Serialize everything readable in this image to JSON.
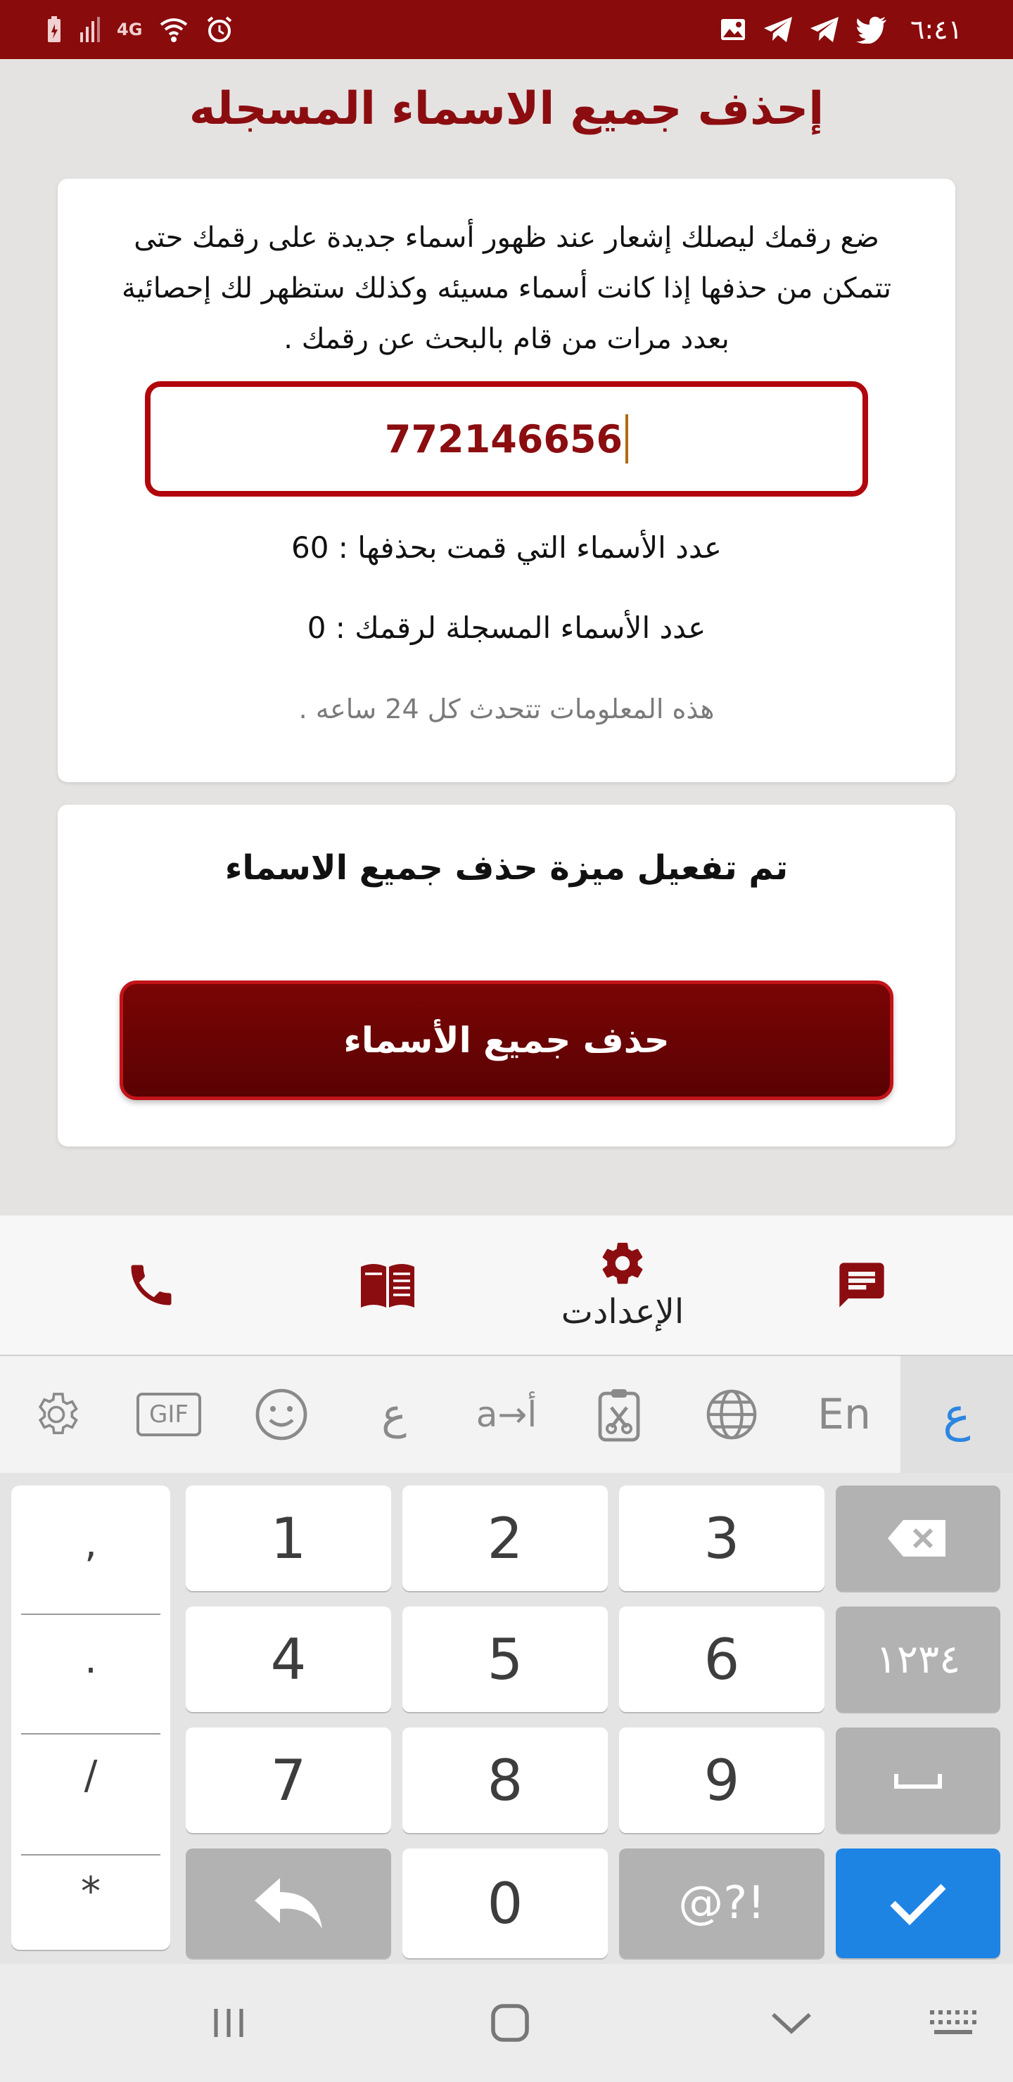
{
  "status_bar": {
    "time": "٦:٤١",
    "network": "4G",
    "left_icons": [
      "battery-icon",
      "signal-icon",
      "wifi-icon",
      "alarm-icon"
    ],
    "right_icons": [
      "gallery-icon",
      "telegram-icon",
      "telegram-icon",
      "twitter-icon"
    ]
  },
  "page": {
    "title": "إحذف جميع الاسماء المسجله"
  },
  "info_card": {
    "description_line1": "ضع رقمك ليصلك إشعار عند ظهور أسماء جديدة على رقمك حتى",
    "description_line2": "تتمكن من حذفها إذا كانت أسماء مسيئه وكذلك ستظهر لك إحصائية",
    "description_line3": "بعدد مرات من قام بالبحث عن رقمك .",
    "phone_value": "772146656",
    "deleted_count_text": "عدد الأسماء التي قمت بحذفها : 60",
    "registered_count_text": "عدد الأسماء المسجلة لرقمك : 0",
    "update_note": "هذه المعلومات تتحدث كل 24 ساعه ."
  },
  "delete_card": {
    "feature_status": "تم تفعيل ميزة حذف جميع الاسماء",
    "delete_button_label": "حذف جميع الأسماء"
  },
  "bottom_nav": {
    "settings_label": "الإعدادت",
    "icons": [
      "phone-icon",
      "book-icon",
      "gear-icon",
      "message-icon"
    ]
  },
  "keyboard": {
    "toolbar": {
      "arabic_label": "ع",
      "english_label": "En",
      "translate_label": "a→أ",
      "arabic_font_label": "ع",
      "gif_label": "GIF"
    },
    "keys": {
      "k1": "1",
      "k2": "2",
      "k3": "3",
      "k4": "4",
      "k5": "5",
      "k6": "6",
      "k7": "7",
      "k8": "8",
      "k9": "9",
      "k0": "0",
      "arabic_digits": "١٢٣٤",
      "symbols": "@?!"
    },
    "side_keys": [
      ",",
      ".",
      "/",
      "*"
    ]
  },
  "colors": {
    "brand_red": "#8b0d10",
    "status_bar": "#8a0b0c",
    "keyboard_accent": "#1e84e4"
  }
}
